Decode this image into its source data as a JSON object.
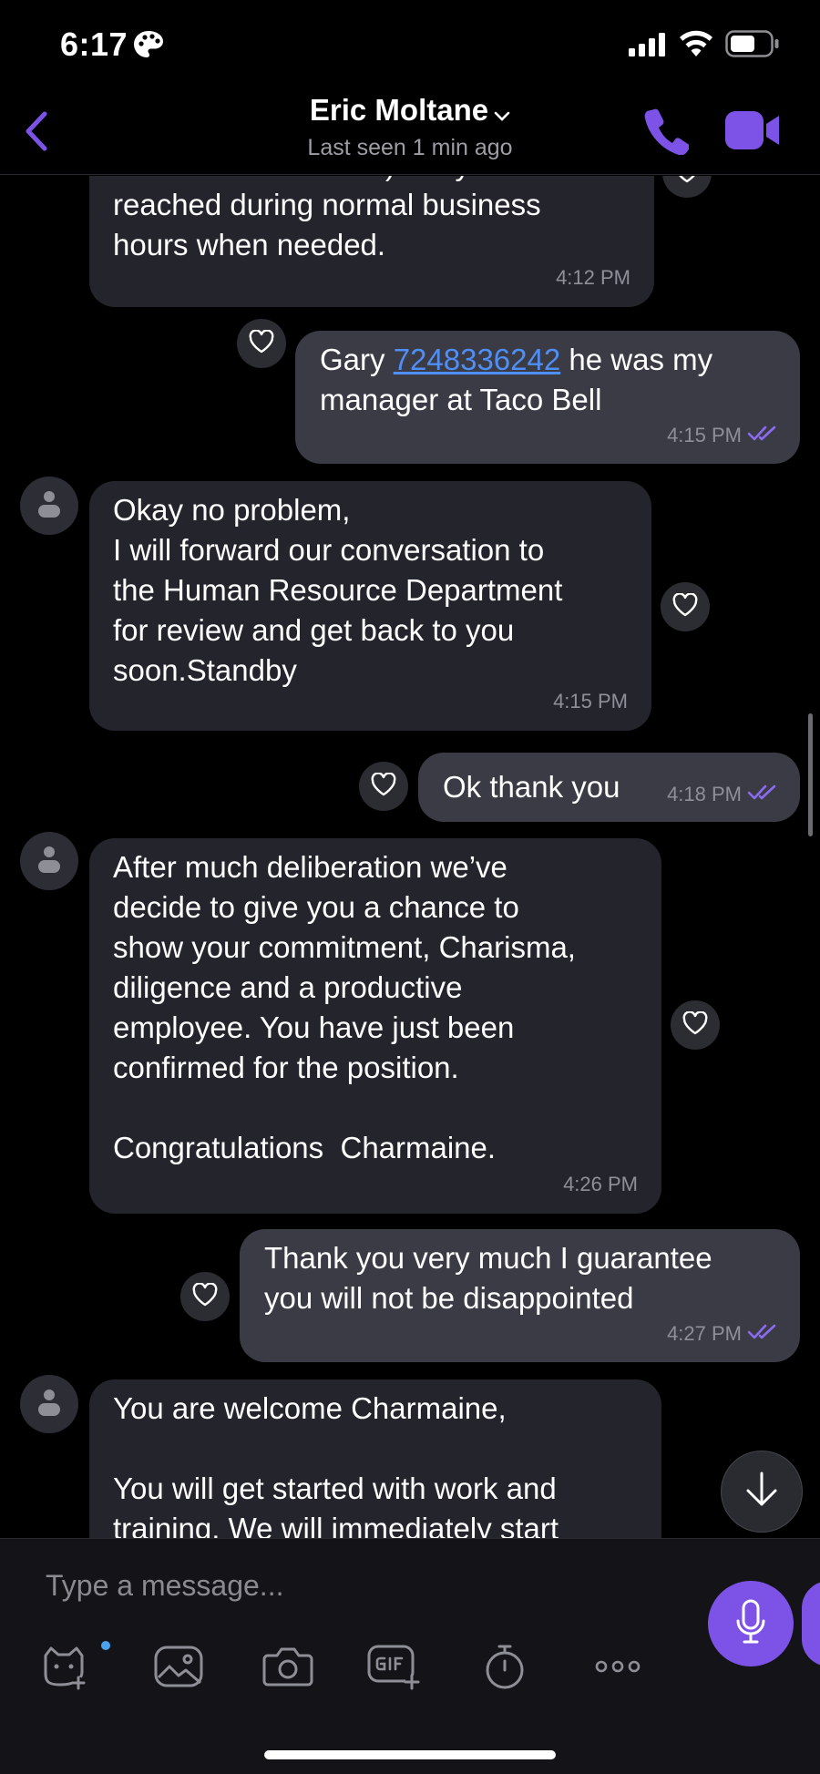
{
  "status_bar": {
    "time": "6:17"
  },
  "header": {
    "contact_name": "Eric Moltane",
    "last_seen": "Last seen 1 min ago"
  },
  "messages": [
    {
      "direction": "incoming",
      "text": "and Phone Contacts) They will be\nreached during normal business\nhours when needed.",
      "time": "4:12 PM"
    },
    {
      "direction": "outgoing",
      "text_before": "Gary ",
      "phone": "7248336242",
      "text_after": " he was my\nmanager at Taco Bell",
      "time": "4:15 PM"
    },
    {
      "direction": "incoming",
      "text": "Okay no problem,\nI will forward our conversation to\nthe Human Resource Department\nfor review and get back to you\nsoon.Standby",
      "time": "4:15 PM"
    },
    {
      "direction": "outgoing",
      "text": "Ok thank you",
      "time": "4:18 PM"
    },
    {
      "direction": "incoming",
      "text": "After much deliberation we’ve\ndecide to give you a chance to\nshow your commitment, Charisma,\ndiligence and a productive\nemployee. You have just been\nconfirmed for the position.\n\nCongratulations  Charmaine.",
      "time": "4:26 PM"
    },
    {
      "direction": "outgoing",
      "text": "Thank you very much I guarantee\nyou will not be disappointed",
      "time": "4:27 PM"
    },
    {
      "direction": "incoming",
      "text": "You are welcome Charmaine,\n\nYou will get started with work and\ntraining. We will immediately start"
    }
  ],
  "composer": {
    "placeholder": "Type a message..."
  },
  "icons": {
    "back": "chevron-left-icon",
    "call": "phone-icon",
    "video": "video-camera-icon",
    "reaction": "heart-outline-icon",
    "scroll": "arrow-down-icon",
    "mic": "microphone-icon",
    "tools": [
      "sticker-icon",
      "gallery-icon",
      "camera-icon",
      "gif-icon",
      "timer-icon",
      "more-icon"
    ]
  },
  "colors": {
    "accent": "#7c53e6",
    "incoming_bubble": "#24252c",
    "outgoing_bubble": "#3a3b45",
    "link": "#4f8ef5",
    "read_ticks": "#8b6cf0"
  }
}
